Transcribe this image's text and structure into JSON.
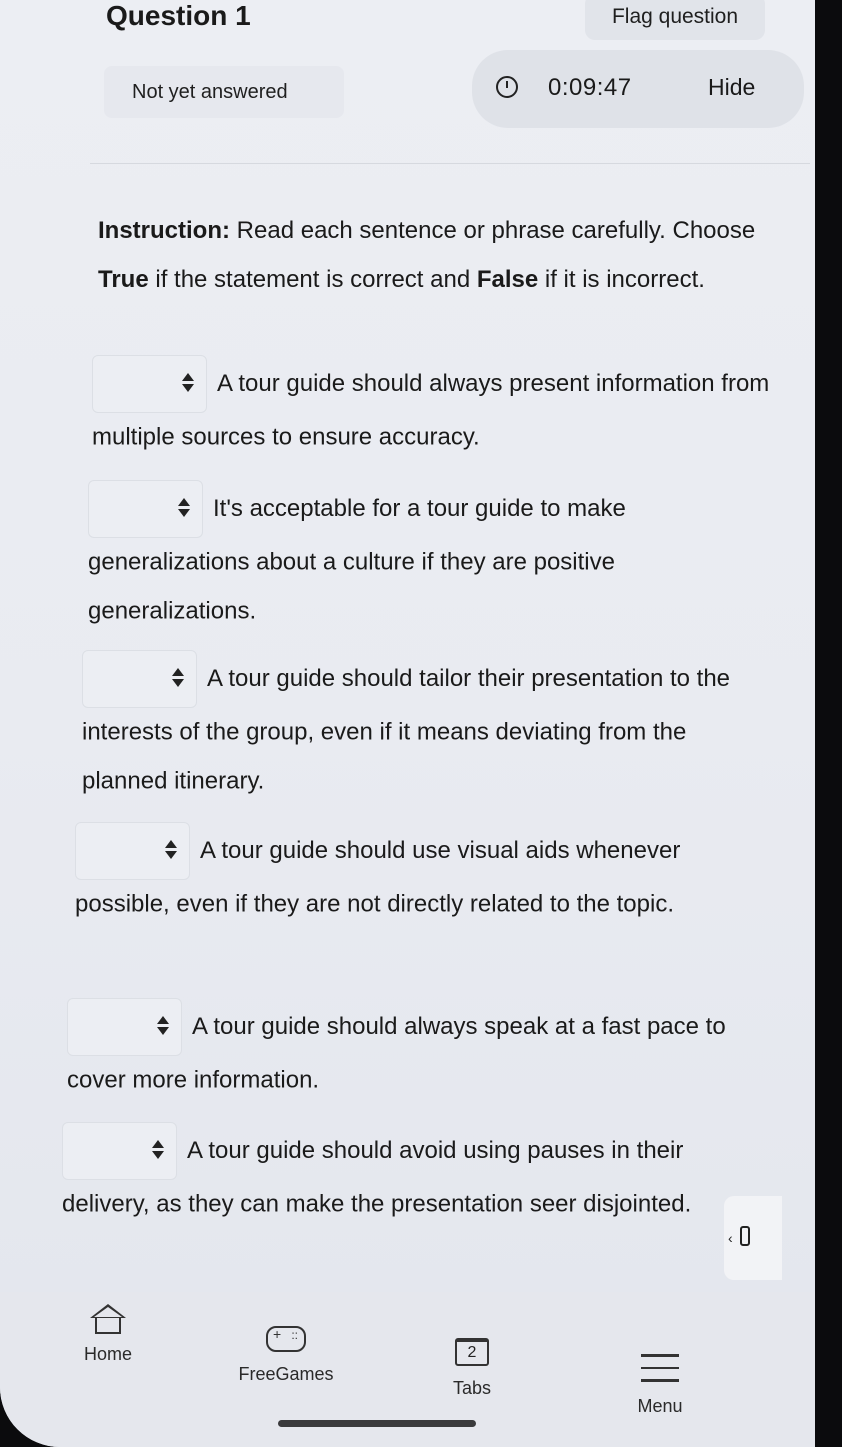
{
  "header": {
    "question_title": "Question 1",
    "flag_label": "Flag question",
    "status": "Not yet answered",
    "timer": "0:09:47",
    "hide_label": "Hide"
  },
  "instruction": {
    "label": "Instruction:",
    "line1_rest": "Read each sentence or phrase carefully.",
    "choose": "Choose",
    "true_word": "True",
    "mid": "if the statement is correct and",
    "false_word": "False",
    "end": "if it is incorrect."
  },
  "questions": [
    {
      "text": "A tour guide should always present information from multiple sources to ensure accuracy."
    },
    {
      "text": "It's acceptable for a tour guide to make generalizations about a culture if they are positive generalizations."
    },
    {
      "text": "A tour guide should tailor their presentation to the interests of the group, even if it means deviating from the planned itinerary."
    },
    {
      "text": "A tour guide should use visual aids whenever possible, even if they are not directly related to the topic."
    },
    {
      "text": "A tour guide should always speak at a fast pace to cover more information."
    },
    {
      "text": "A tour guide should avoid using pauses in their delivery, as they can make the presentation seer disjointed."
    }
  ],
  "nav": {
    "home": "Home",
    "freegames": "FreeGames",
    "tabs_count": "2",
    "tabs": "Tabs",
    "menu": "Menu"
  },
  "icons": [
    "clock-icon",
    "updown-arrows-icon",
    "home-icon",
    "gamepad-icon",
    "tabs-icon",
    "menu-icon",
    "side-panel-icon"
  ]
}
